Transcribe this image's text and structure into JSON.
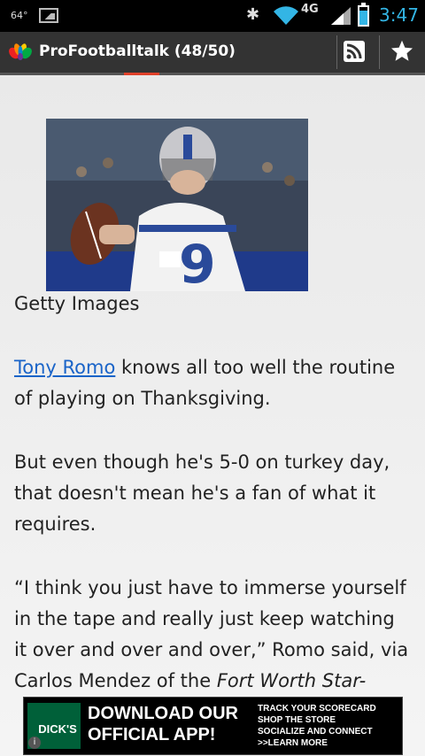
{
  "status": {
    "temperature": "64°",
    "network": "4G",
    "time": "3:47"
  },
  "actionbar": {
    "title": "ProFootballtalk (48/50)",
    "rss_icon": "rss-icon",
    "star_icon": "star-icon"
  },
  "article": {
    "photo_caption": "Getty Images",
    "p1_link": "Tony Romo",
    "p1_rest": " knows all too well the routine of playing on Thanksgiving.",
    "p2": "But even though he's 5-0 on turkey day, that doesn't mean he's a fan of what it requires.",
    "p3_start": "“I think you just have to immerse yourself in the tape and really just keep watching it over and over and over,” Romo said, via Carlos Mendez of the ",
    "p3_italic": "Fort Worth Star-"
  },
  "ad": {
    "brand": "DICK'S",
    "headline_1": "DOWNLOAD OUR",
    "headline_2": "OFFICIAL APP!",
    "line_1": "TRACK YOUR SCORECARD",
    "line_2": "SHOP THE STORE",
    "line_3": "SOCIALIZE AND CONNECT",
    "line_4": ">>LEARN MORE",
    "info_icon": "i"
  }
}
